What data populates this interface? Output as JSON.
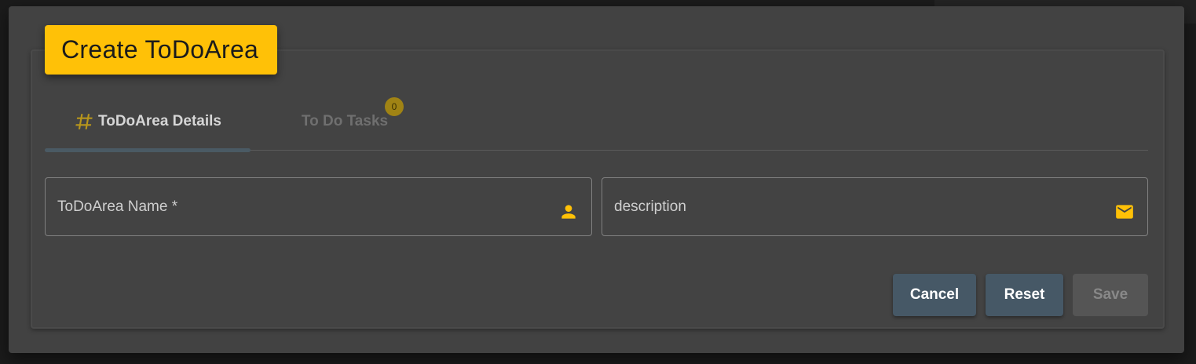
{
  "dialog": {
    "title": "Create ToDoArea"
  },
  "tabs": [
    {
      "label": "ToDoArea Details",
      "icon": "hash-icon",
      "active": true
    },
    {
      "label": "To Do Tasks",
      "badge_count": "0",
      "active": false
    }
  ],
  "form": {
    "name_field": {
      "placeholder": "ToDoArea Name *",
      "value": "",
      "icon": "person-icon"
    },
    "description_field": {
      "placeholder": "description",
      "value": "",
      "icon": "mail-icon"
    }
  },
  "actions": {
    "cancel_label": "Cancel",
    "reset_label": "Reset",
    "save_label": "Save"
  },
  "colors": {
    "accent": "#ffc107",
    "dialog_bg": "#424242",
    "button_bg": "#465866",
    "badge_bg": "#a08314"
  }
}
